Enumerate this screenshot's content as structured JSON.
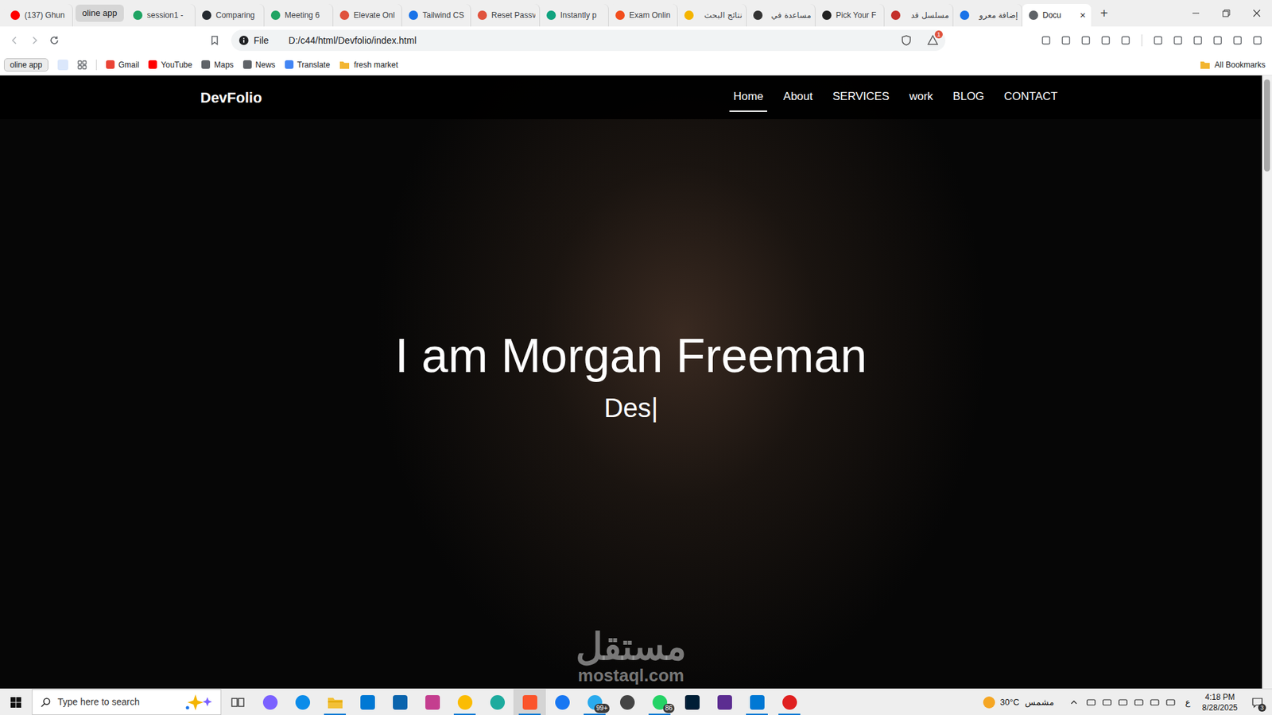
{
  "browser": {
    "tabs": [
      {
        "label": "(137) Ghun",
        "kind": "tab",
        "selected": false,
        "color": "#ff0000"
      },
      {
        "label": "oline app",
        "kind": "group",
        "selected": false,
        "color": "#d6d6d6"
      },
      {
        "label": "session1 -",
        "kind": "tab",
        "selected": false,
        "color": "#1fa463"
      },
      {
        "label": "Comparing",
        "kind": "tab",
        "selected": false,
        "color": "#24292f"
      },
      {
        "label": "Meeting 6",
        "kind": "tab",
        "selected": false,
        "color": "#1fa463"
      },
      {
        "label": "Elevate Onl",
        "kind": "tab",
        "selected": false,
        "color": "#e0533d"
      },
      {
        "label": "Tailwind CS",
        "kind": "tab",
        "selected": false,
        "color": "#1a73e8"
      },
      {
        "label": "Reset Passv",
        "kind": "tab",
        "selected": false,
        "color": "#e0533d"
      },
      {
        "label": "Instantly p",
        "kind": "tab",
        "selected": false,
        "color": "#10a37f"
      },
      {
        "label": "Exam Onlin",
        "kind": "tab",
        "selected": false,
        "color": "#f24e1e"
      },
      {
        "label": "نتائج البحث",
        "kind": "tab",
        "selected": false,
        "color": "#f4b400"
      },
      {
        "label": "مساعدة في",
        "kind": "tab",
        "selected": false,
        "color": "#333333"
      },
      {
        "label": "Pick Your F",
        "kind": "tab",
        "selected": false,
        "color": "#222222"
      },
      {
        "label": "مسلسل قد",
        "kind": "tab",
        "selected": false,
        "color": "#c4302b"
      },
      {
        "label": "إضافة معرو",
        "kind": "tab",
        "selected": false,
        "color": "#1a73e8"
      },
      {
        "label": "Docu",
        "kind": "tab",
        "selected": true,
        "color": "#5f6368"
      }
    ],
    "close_tab": "×",
    "new_tab": "+",
    "address": {
      "scheme": "File",
      "url": "D:/c44/html/Devfolio/index.html"
    },
    "rewards_badge": "1",
    "bookmark_group": "oline app",
    "bookmarks": [
      {
        "label": "Gmail",
        "color": "#ea4335"
      },
      {
        "label": "YouTube",
        "color": "#ff0000"
      },
      {
        "label": "Maps",
        "color": "#5f6368"
      },
      {
        "label": "News",
        "color": "#5f6368"
      },
      {
        "label": "Translate",
        "color": "#4285f4"
      },
      {
        "label": "fresh market",
        "color": "#f2b531"
      }
    ],
    "all_bookmarks": "All Bookmarks",
    "scroll": {
      "level": 0.15
    }
  },
  "page": {
    "brand": "DevFolio",
    "nav": [
      {
        "label": "Home",
        "selected": true
      },
      {
        "label": "About",
        "selected": false
      },
      {
        "label": "SERVICES",
        "selected": false
      },
      {
        "label": "work",
        "selected": false
      },
      {
        "label": "BLOG",
        "selected": false
      },
      {
        "label": "CONTACT",
        "selected": false
      }
    ],
    "hero": {
      "title": "I am Morgan Freeman",
      "subtitle": "Des",
      "cursor": "|"
    }
  },
  "watermark": {
    "arabic": "مستقل",
    "latin": "mostaql.com"
  },
  "taskbar": {
    "search_placeholder": "Type here to search",
    "apps": [
      {
        "kind": "taskview",
        "color": "#333333",
        "running": false,
        "selected": false,
        "badge": ""
      },
      {
        "kind": "circle",
        "color": "#7b61ff",
        "running": false,
        "selected": false,
        "badge": ""
      },
      {
        "kind": "circle",
        "color": "#0c8ce9",
        "running": false,
        "selected": false,
        "badge": ""
      },
      {
        "kind": "folder",
        "color": "#f2c037",
        "running": true,
        "selected": false,
        "badge": ""
      },
      {
        "kind": "square",
        "color": "#0078d4",
        "running": false,
        "selected": false,
        "badge": ""
      },
      {
        "kind": "square",
        "color": "#0a64ad",
        "running": false,
        "selected": false,
        "badge": ""
      },
      {
        "kind": "square",
        "color": "#c43e8f",
        "running": false,
        "selected": false,
        "badge": ""
      },
      {
        "kind": "circle",
        "color": "#fbbc04",
        "running": true,
        "selected": false,
        "badge": ""
      },
      {
        "kind": "circle",
        "color": "#1dab9e",
        "running": false,
        "selected": false,
        "badge": ""
      },
      {
        "kind": "square",
        "color": "#fb542b",
        "running": true,
        "selected": true,
        "badge": ""
      },
      {
        "kind": "circle",
        "color": "#1877f2",
        "running": false,
        "selected": false,
        "badge": ""
      },
      {
        "kind": "circle",
        "color": "#2aabee",
        "running": true,
        "selected": false,
        "badge": "99+"
      },
      {
        "kind": "circle",
        "color": "#444444",
        "running": false,
        "selected": false,
        "badge": ""
      },
      {
        "kind": "circle",
        "color": "#25d366",
        "running": true,
        "selected": false,
        "badge": "86"
      },
      {
        "kind": "square",
        "color": "#001e36",
        "running": false,
        "selected": false,
        "badge": ""
      },
      {
        "kind": "square",
        "color": "#5c2d91",
        "running": false,
        "selected": false,
        "badge": ""
      },
      {
        "kind": "square",
        "color": "#0078d4",
        "running": true,
        "selected": false,
        "badge": ""
      },
      {
        "kind": "circle",
        "color": "#e02020",
        "running": true,
        "selected": false,
        "badge": ""
      }
    ],
    "tray": {
      "weather": "30°C",
      "condition": "مشمس",
      "lang": "ع",
      "time": "4:18 PM",
      "date": "8/28/2025",
      "notifications": "3"
    }
  }
}
